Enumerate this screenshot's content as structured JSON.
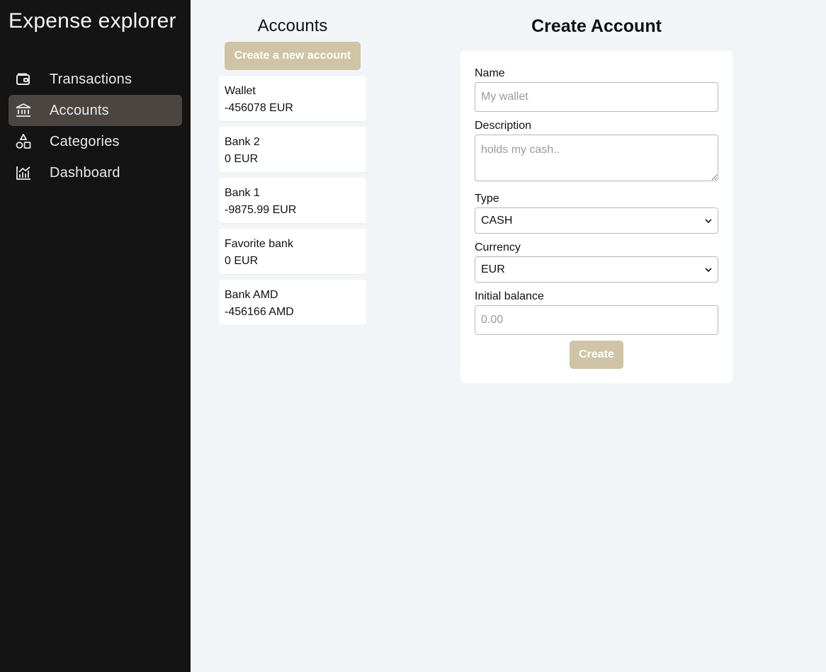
{
  "app": {
    "title": "Expense explorer"
  },
  "sidebar": {
    "items": [
      {
        "label": "Transactions",
        "icon": "wallet-icon",
        "active": false
      },
      {
        "label": "Accounts",
        "icon": "bank-icon",
        "active": true
      },
      {
        "label": "Categories",
        "icon": "shapes-icon",
        "active": false
      },
      {
        "label": "Dashboard",
        "icon": "chart-icon",
        "active": false
      }
    ]
  },
  "accounts": {
    "title": "Accounts",
    "new_button": "Create a new account",
    "items": [
      {
        "name": "Wallet",
        "balance": "-456078 EUR"
      },
      {
        "name": "Bank 2",
        "balance": "0 EUR"
      },
      {
        "name": "Bank 1",
        "balance": "-9875.99 EUR"
      },
      {
        "name": "Favorite bank",
        "balance": "0 EUR"
      },
      {
        "name": "Bank AMD",
        "balance": "-456166 AMD"
      }
    ]
  },
  "form": {
    "title": "Create Account",
    "name_label": "Name",
    "name_placeholder": "My wallet",
    "description_label": "Description",
    "description_placeholder": "holds my cash..",
    "type_label": "Type",
    "type_value": "CASH",
    "currency_label": "Currency",
    "currency_value": "EUR",
    "balance_label": "Initial balance",
    "balance_placeholder": "0.00",
    "create_button": "Create"
  },
  "colors": {
    "sidebar_bg": "#141414",
    "active_nav_bg": "#4a4541",
    "accent": "#cfc4a4",
    "page_bg": "#f2f5f8"
  }
}
